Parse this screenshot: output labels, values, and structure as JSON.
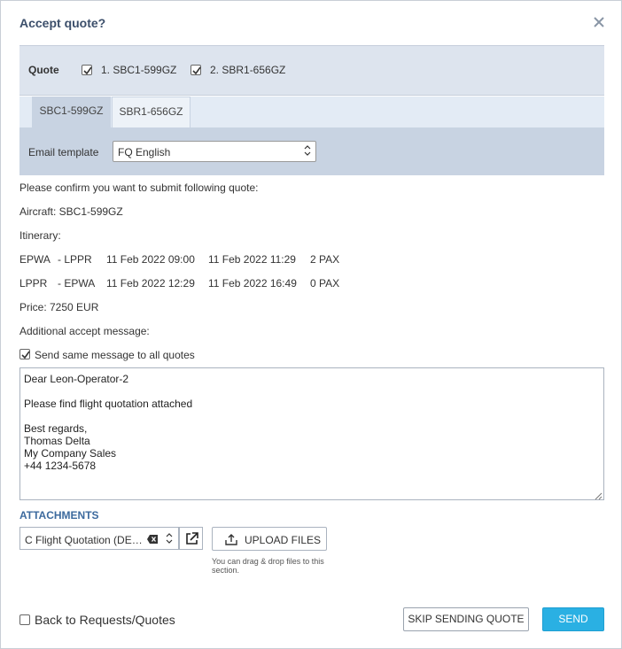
{
  "dialog": {
    "title": "Accept quote?",
    "close_icon": "close-icon"
  },
  "quote": {
    "label": "Quote",
    "options": [
      {
        "label": "1. SBC1-599GZ",
        "checked": true
      },
      {
        "label": "2. SBR1-656GZ",
        "checked": true
      }
    ]
  },
  "tabs": [
    {
      "label": "SBC1-599GZ",
      "active": true
    },
    {
      "label": "SBR1-656GZ",
      "active": false
    }
  ],
  "email_template": {
    "label": "Email template",
    "value": "FQ English"
  },
  "summary": {
    "confirm": "Please confirm you want to submit following quote:",
    "aircraft": "Aircraft: SBC1-599GZ",
    "itinerary_label": "Itinerary:",
    "legs": [
      {
        "from": "EPWA",
        "to": "- LPPR",
        "dep": "11 Feb 2022 09:00",
        "arr": "11 Feb 2022 11:29",
        "pax": "2 PAX"
      },
      {
        "from": "LPPR",
        "to": "- EPWA",
        "dep": "11 Feb 2022 12:29",
        "arr": "11 Feb 2022 16:49",
        "pax": "0 PAX"
      }
    ],
    "price": "Price: 7250 EUR",
    "additional_label": "Additional accept message:"
  },
  "send_same": {
    "label": "Send same message to all quotes",
    "checked": true
  },
  "message": {
    "lines": [
      "Dear Leon-Operator-2",
      "",
      "Please find flight quotation attached",
      "",
      "Best regards,",
      "Thomas Delta",
      "My Company Sales",
      "+44 1234-5678"
    ]
  },
  "attachments": {
    "title": "ATTACHMENTS",
    "selected": "C Flight Quotation (DEFAULT)",
    "upload_label": "UPLOAD FILES",
    "drop_hint": "You can drag & drop files to this section."
  },
  "footer": {
    "back_label": "Back to Requests/Quotes",
    "back_checked": false,
    "skip_label": "SKIP SENDING QUOTE",
    "send_label": "SEND"
  },
  "colors": {
    "accent": "#2ab0e3",
    "header_band": "#dde4ee",
    "template_band": "#c8d3e2",
    "title": "#3c4f6b"
  }
}
